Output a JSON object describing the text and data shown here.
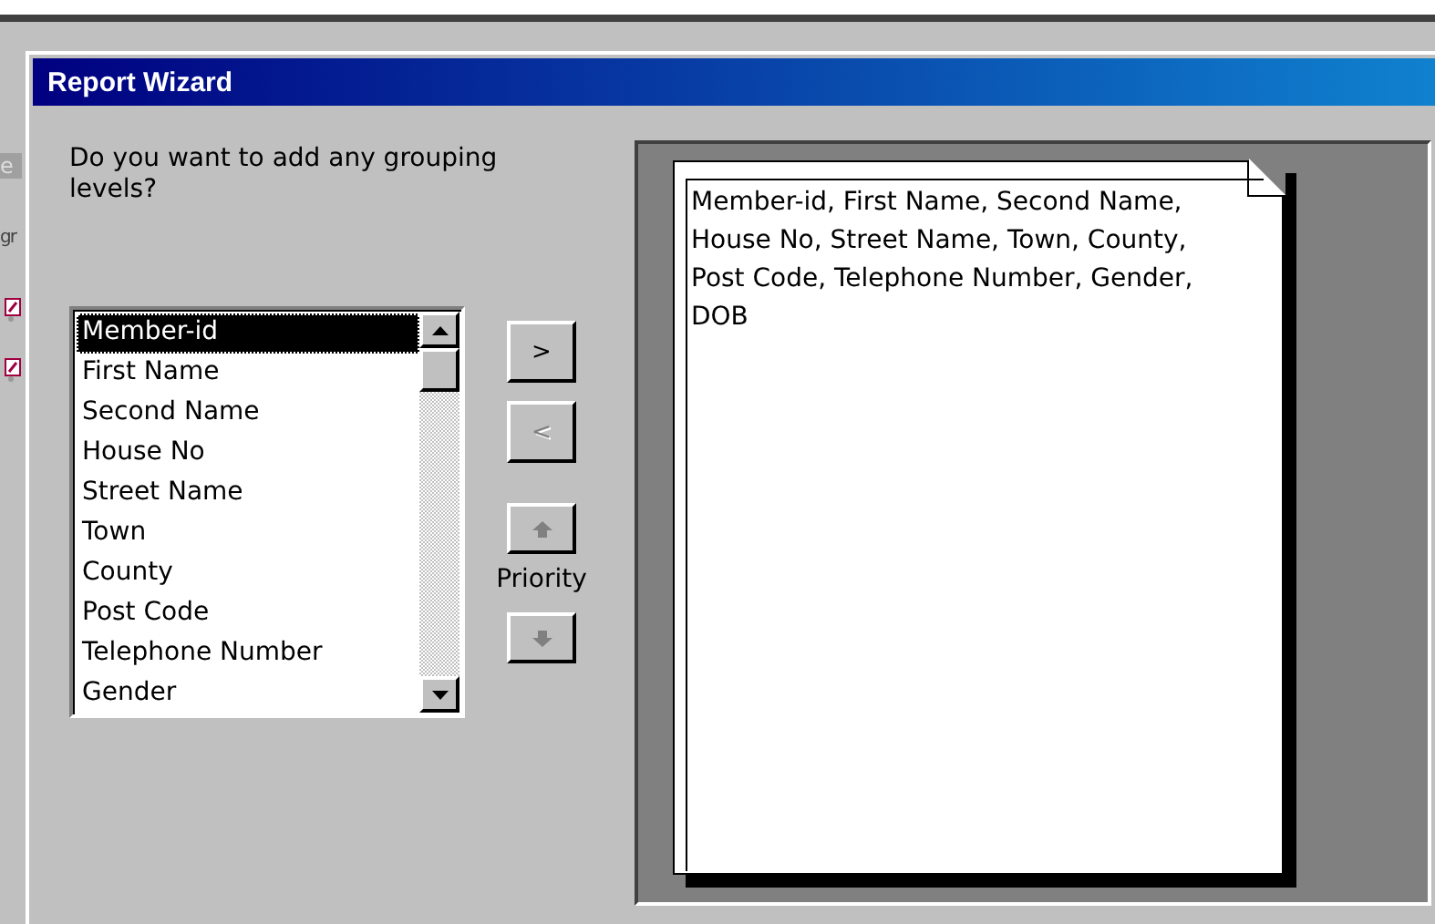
{
  "background_window": {
    "texts": [
      "e",
      "gr"
    ]
  },
  "window": {
    "title": "Report Wizard"
  },
  "question": "Do you want to add any grouping levels?",
  "fields": [
    {
      "label": "Member-id",
      "selected": true
    },
    {
      "label": "First Name",
      "selected": false
    },
    {
      "label": "Second Name",
      "selected": false
    },
    {
      "label": "House No",
      "selected": false
    },
    {
      "label": "Street Name",
      "selected": false
    },
    {
      "label": "Town",
      "selected": false
    },
    {
      "label": "County",
      "selected": false
    },
    {
      "label": "Post Code",
      "selected": false
    },
    {
      "label": "Telephone Number",
      "selected": false
    },
    {
      "label": "Gender",
      "selected": false
    }
  ],
  "buttons": [
    {
      "kind": "text",
      "label": ">",
      "disabled": false
    },
    {
      "kind": "text",
      "label": "<",
      "disabled": true
    },
    {
      "kind": "up",
      "disabled": true
    },
    {
      "kind": "down",
      "disabled": true
    }
  ],
  "priority_label": "Priority",
  "preview": {
    "text": "Member-id, First Name, Second Name, House No, Street Name, Town, County, Post Code, Telephone Number, Gender, DOB"
  }
}
